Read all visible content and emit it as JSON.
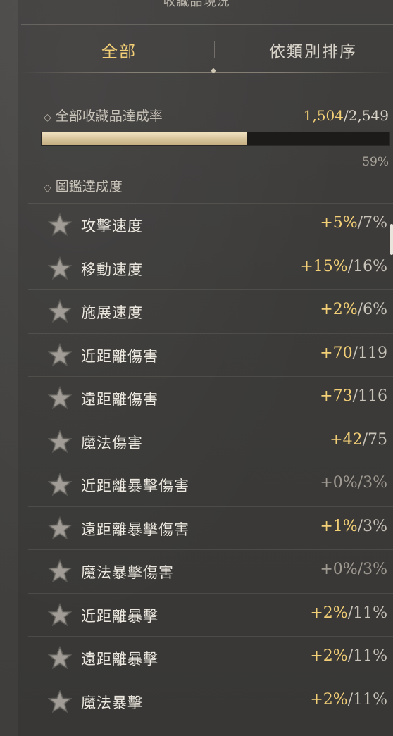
{
  "header": {
    "title": "收藏品現況"
  },
  "tabs": [
    {
      "label": "全部",
      "active": true
    },
    {
      "label": "依類別排序",
      "active": false
    }
  ],
  "summary": {
    "label": "全部收藏品達成率",
    "current": "1,504",
    "total": "/2,549",
    "progress_fraction": 0.59,
    "percent": "59%"
  },
  "codex": {
    "label": "圖鑑達成度",
    "rows": [
      {
        "label": "攻擊速度",
        "bonus": "+5%",
        "max": "/7%",
        "state": "active"
      },
      {
        "label": "移動速度",
        "bonus": "+15%",
        "max": "/16%",
        "state": "active"
      },
      {
        "label": "施展速度",
        "bonus": "+2%",
        "max": "/6%",
        "state": "active"
      },
      {
        "label": "近距離傷害",
        "bonus": "+70",
        "max": "/119",
        "state": "active"
      },
      {
        "label": "遠距離傷害",
        "bonus": "+73",
        "max": "/116",
        "state": "active"
      },
      {
        "label": "魔法傷害",
        "bonus": "+42",
        "max": "/75",
        "state": "active"
      },
      {
        "label": "近距離暴擊傷害",
        "bonus": "+0%",
        "max": "/3%",
        "state": "zero"
      },
      {
        "label": "遠距離暴擊傷害",
        "bonus": "+1%",
        "max": "/3%",
        "state": "active"
      },
      {
        "label": "魔法暴擊傷害",
        "bonus": "+0%",
        "max": "/3%",
        "state": "zero"
      },
      {
        "label": "近距離暴擊",
        "bonus": "+2%",
        "max": "/11%",
        "state": "active"
      },
      {
        "label": "遠距離暴擊",
        "bonus": "+2%",
        "max": "/11%",
        "state": "active"
      },
      {
        "label": "魔法暴擊",
        "bonus": "+2%",
        "max": "/11%",
        "state": "active"
      }
    ]
  },
  "icons": {
    "row_icon": "star-icon",
    "section_icon": "diamond-icon"
  },
  "colors": {
    "accent": "#f2cf76",
    "text": "#ece8df",
    "muted": "#9f9a91",
    "progress_fill": "#d6c39b"
  }
}
